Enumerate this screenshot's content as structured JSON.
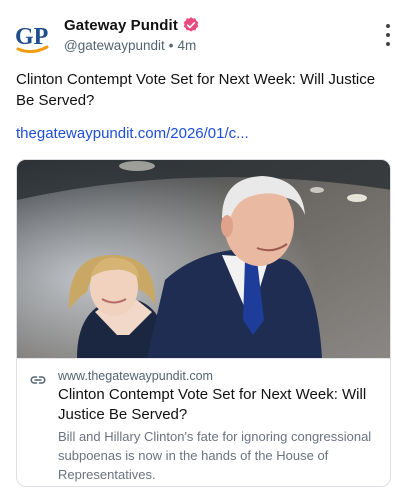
{
  "author": {
    "display_name": "Gateway Pundit",
    "handle": "@gatewaypundit",
    "separator": "•",
    "time_ago": "4m",
    "avatar_text": "GP",
    "verified": true
  },
  "post": {
    "text": "Clinton Contempt Vote Set for Next Week: Will Justice Be Served?",
    "link_text": "thegatewaypundit.com/2026/01/c..."
  },
  "link_card": {
    "domain": "www.thegatewaypundit.com",
    "title": "Clinton Contempt Vote Set for Next Week: Will Justice Be Served?",
    "description": "Bill and Hillary Clinton's fate for ignoring congressional subpoenas is now in the hands of the House of Representatives."
  },
  "icons": {
    "verified": "verified-badge-icon",
    "more": "more-vertical-icon",
    "link": "link-icon"
  },
  "colors": {
    "link": "#1d4ed8",
    "verified_badge": "#e84a7f",
    "secondary_text": "#536471",
    "avatar_blue": "#1f4e8c",
    "avatar_orange": "#f39c12"
  }
}
